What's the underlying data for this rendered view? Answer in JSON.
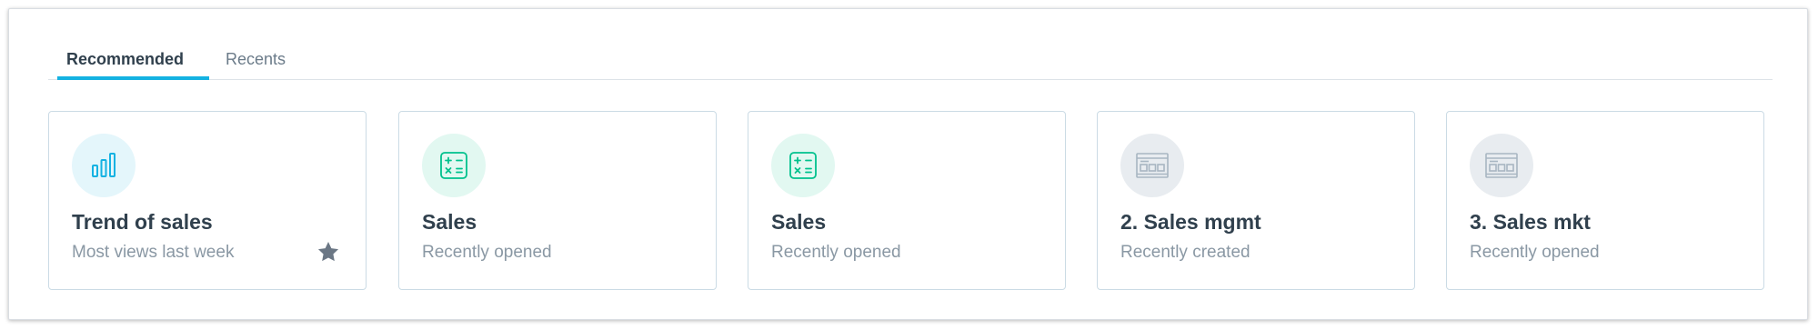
{
  "tabs": [
    {
      "label": "Recommended",
      "active": true
    },
    {
      "label": "Recents",
      "active": false
    }
  ],
  "cards": [
    {
      "title": "Trend of sales",
      "subtitle": "Most views last week",
      "icon": "bar-chart-icon",
      "icon_bg": "#e4f6fb",
      "icon_color": "#14b2e2",
      "favorite": true
    },
    {
      "title": "Sales",
      "subtitle": "Recently opened",
      "icon": "calculator-icon",
      "icon_bg": "#e2f8f1",
      "icon_color": "#00c18d",
      "favorite": false
    },
    {
      "title": "Sales",
      "subtitle": "Recently opened",
      "icon": "calculator-icon",
      "icon_bg": "#e2f8f1",
      "icon_color": "#00c18d",
      "favorite": false
    },
    {
      "title": "2. Sales mgmt",
      "subtitle": "Recently created",
      "icon": "dashboard-icon",
      "icon_bg": "#e8ecf0",
      "icon_color": "#a8b6c2",
      "favorite": false
    },
    {
      "title": "3. Sales mkt",
      "subtitle": "Recently opened",
      "icon": "dashboard-icon",
      "icon_bg": "#e8ecf0",
      "icon_color": "#a8b6c2",
      "favorite": false
    }
  ],
  "colors": {
    "accent": "#14b2e2",
    "title": "#30404d",
    "subtitle": "#8a98a4",
    "star": "#6b7785"
  }
}
